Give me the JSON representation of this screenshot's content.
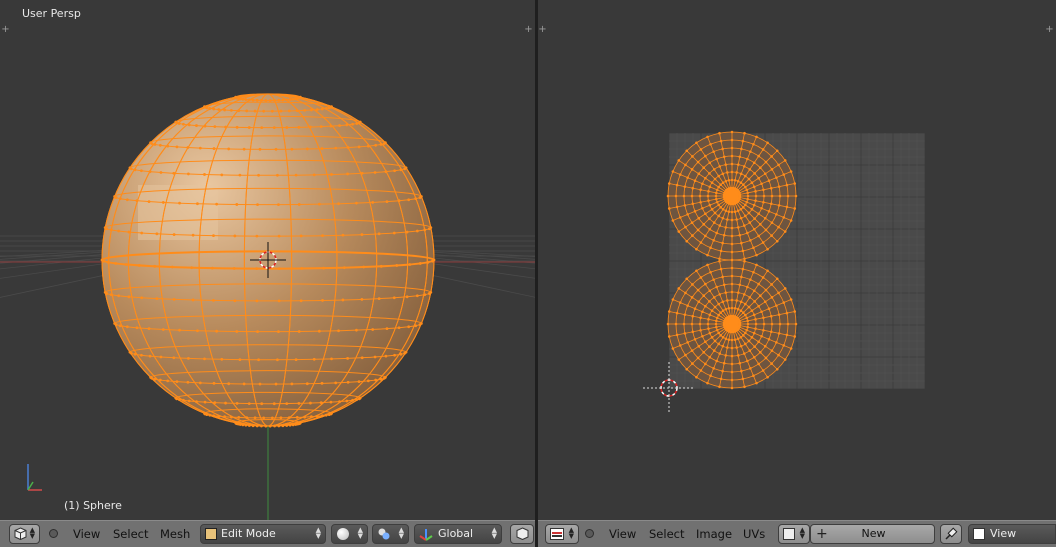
{
  "viewport3d": {
    "title": "User Persp",
    "object_label": "(1) Sphere",
    "header": {
      "menus": [
        "View",
        "Select",
        "Mesh"
      ],
      "mode": "Edit Mode",
      "orientation": "Global"
    }
  },
  "uv_editor": {
    "header": {
      "menus": [
        "View",
        "Select",
        "Image",
        "UVs"
      ],
      "new_label": "New",
      "view_label": "View"
    }
  },
  "colors": {
    "bg_viewport": "#393939",
    "header": "#717171",
    "selection": "#ff8c1a",
    "sphere": "#b08255"
  },
  "icons": [
    "plus-corner-icon",
    "editor-type-icon",
    "cube-icon",
    "sphere-shading-icon",
    "pivot-icon",
    "transform-manipulator-icon",
    "image-icon",
    "pin-icon",
    "axis-gizmo-icon",
    "3d-cursor-icon"
  ]
}
